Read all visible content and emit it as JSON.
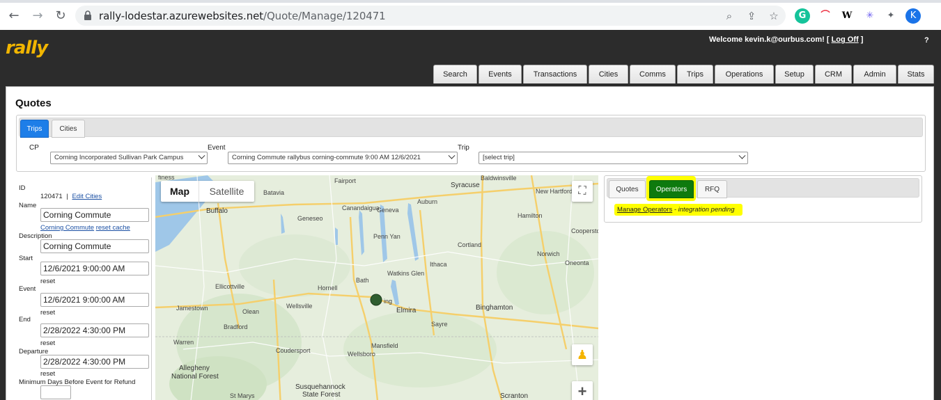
{
  "browser": {
    "url_host": "rally-lodestar.azurewebsites.net",
    "url_path": "/Quote/Manage/120471",
    "profile_initial": "K"
  },
  "header": {
    "logo_text": "rally",
    "welcome_prefix": "Welcome kevin.k@ourbus.com! [",
    "logoff_label": "Log Off",
    "welcome_suffix": "]",
    "help_label": "?"
  },
  "nav": {
    "tabs": [
      "Search",
      "Events",
      "Transactions",
      "Cities",
      "Comms",
      "Trips",
      "Operations",
      "Setup",
      "CRM",
      "Admin",
      "Stats"
    ]
  },
  "page": {
    "title": "Quotes",
    "subtabs": [
      "Trips",
      "Cities"
    ],
    "filters": {
      "cp_label": "CP",
      "cp_value": "Corning Incorporated Sullivan Park Campus",
      "event_label": "Event",
      "event_value": "Corning Commute rallybus corning-commute 9:00 AM 12/6/2021",
      "trip_label": "Trip",
      "trip_value": "[select trip]"
    }
  },
  "form": {
    "id_label": "ID",
    "id_value": "120471",
    "id_sep": "|",
    "edit_cities": "Edit Cities",
    "name_label": "Name",
    "name_value": "Corning Commute",
    "name_link": "Corning Commute",
    "reset_cache": "reset cache",
    "description_label": "Description",
    "description_value": "Corning Commute",
    "start_label": "Start",
    "start_value": "12/6/2021 9:00:00 AM",
    "event_label": "Event",
    "event_value": "12/6/2021 9:00:00 AM",
    "end_label": "End",
    "end_value": "2/28/2022 4:30:00 PM",
    "departure_label": "Departure",
    "departure_value": "2/28/2022 4:30:00 PM",
    "reset_label": "reset",
    "min_days_label": "Minimum Days Before Event for Refund"
  },
  "map": {
    "type_map": "Map",
    "type_satellite": "Satellite",
    "labels": {
      "buffalo": "Buffalo",
      "batavia": "Batavia",
      "geneseo": "Geneseo",
      "canandaigua": "Canandaigua",
      "geneva": "Geneva",
      "auburn": "Auburn",
      "syracuse": "Syracuse",
      "fairport": "Fairport",
      "baldwinsville": "Baldwinsville",
      "new_hartford": "New Hartford",
      "hamilton": "Hamilton",
      "cortland": "Cortland",
      "penn_yan": "Penn Yan",
      "ithaca": "Ithaca",
      "norwich": "Norwich",
      "cooperstown": "Cooperstown",
      "oneonta": "Oneonta",
      "watkins_glen": "Watkins Glen",
      "bath": "Bath",
      "hornell": "Hornell",
      "ellicottville": "Ellicottville",
      "wellsville": "Wellsville",
      "olean": "Olean",
      "jamestown": "Jamestown",
      "bradford": "Bradford",
      "elmira": "Elmira",
      "binghamton": "Binghamton",
      "sayre": "Sayre",
      "warren": "Warren",
      "coudersport": "Coudersport",
      "mansfield": "Mansfield",
      "wellsboro": "Wellsboro",
      "allegheny": "Allegheny",
      "national_forest": "National Forest",
      "susquehannock": "Susquehannock",
      "state_forest": "State Forest",
      "st_marys": "St Marys",
      "scranton": "Scranton",
      "ing": "ing",
      "finess": "finess"
    }
  },
  "right": {
    "tabs": [
      "Quotes",
      "Operators",
      "RFQ"
    ],
    "manage_operators": "Manage Operators",
    "integration_note": " - integration pending"
  },
  "colors": {
    "header_bg": "#2c2c2c",
    "logo": "#f1b500",
    "active_tab_blue": "#1e7ee8",
    "operators_green": "#0e7a0e",
    "highlight": "#ffff00",
    "marker": "#2f5d2f"
  }
}
